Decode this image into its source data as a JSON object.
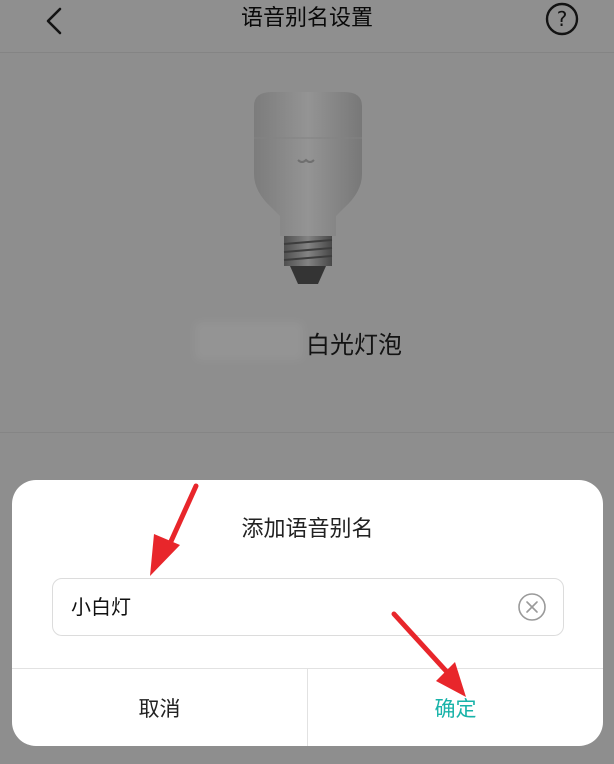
{
  "header": {
    "title": "语音别名设置"
  },
  "device": {
    "name_suffix": "白光灯泡"
  },
  "dialog": {
    "title": "添加语音别名",
    "input_value": "小白灯",
    "cancel_label": "取消",
    "confirm_label": "确定"
  },
  "colors": {
    "accent": "#18b3a9",
    "arrow": "#e8262b"
  },
  "icons": {
    "back": "chevron-left-icon",
    "help": "help-circle-icon",
    "clear": "clear-circle-icon"
  }
}
